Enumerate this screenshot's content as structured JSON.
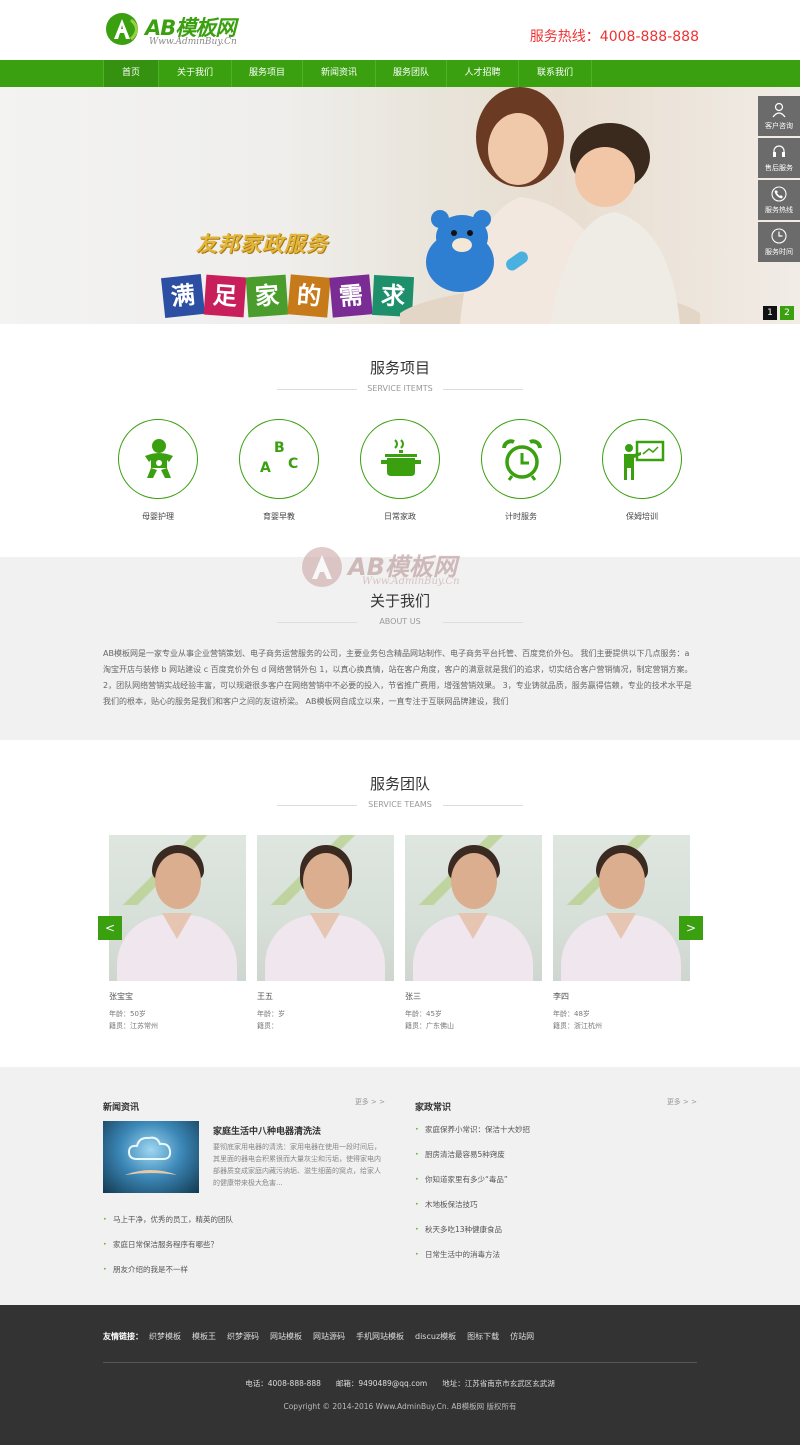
{
  "brand": {
    "name": "AB模板网",
    "url": "Www.AdminBuy.Cn",
    "hotline": "服务热线：4008-888-888",
    "accent": "#3aa010"
  },
  "nav": {
    "items": [
      "首页",
      "关于我们",
      "服务项目",
      "新闻资讯",
      "服务团队",
      "人才招聘",
      "联系我们"
    ]
  },
  "banner": {
    "title": "友邦家政服务",
    "tiles": [
      "满",
      "足",
      "家",
      "的",
      "需",
      "求"
    ],
    "tile_colors": [
      "#2c4fa3",
      "#c81e5a",
      "#4a9d2d",
      "#c77a1a",
      "#7a2b94",
      "#1d8f6a"
    ],
    "pager": [
      "1",
      "2"
    ]
  },
  "sidefloat": {
    "items": [
      {
        "label": "客户咨询",
        "icon": "user-icon"
      },
      {
        "label": "售后服务",
        "icon": "headset-icon"
      },
      {
        "label": "服务热线",
        "icon": "phone-icon"
      },
      {
        "label": "服务时间",
        "icon": "clock-icon"
      }
    ]
  },
  "services": {
    "title": "服务项目",
    "subtitle": "SERVICE ITEMTS",
    "items": [
      {
        "label": "母婴护理",
        "icon": "baby-icon"
      },
      {
        "label": "育婴早教",
        "icon": "abc-icon"
      },
      {
        "label": "日常家政",
        "icon": "pot-icon"
      },
      {
        "label": "计时服务",
        "icon": "alarm-clock-icon"
      },
      {
        "label": "保姆培训",
        "icon": "teacher-icon"
      }
    ]
  },
  "about": {
    "title": "关于我们",
    "subtitle": "ABOUT US",
    "watermark_name": "AB模板网",
    "watermark_url": "Www.AdminBuy.Cn",
    "text": "AB模板网是一家专业从事企业营销策划、电子商务运营服务的公司，主要业务包含精品网站制作、电子商务平台托管、百度竞价外包。 我们主要提供以下几点服务：a 淘宝开店与装修 b 网站建设 c 百度竞价外包 d 网络营销外包 1，以真心换真情，站在客户角度，客户的满意就是我们的追求，切实结合客户营销情况，制定营销方案。 2，团队网络营销实战经验丰富，可以规避很多客户在网络营销中不必要的投入，节省推广费用，增强营销效果。 3，专业铸就品质，服务赢得信赖，专业的技术水平是我们的根本，贴心的服务是我们和客户之间的友谊桥梁。 AB模板网自成立以来，一直专注于互联网品牌建设，我们"
  },
  "team": {
    "title": "服务团队",
    "subtitle": "SERVICE TEAMS",
    "prev": "<",
    "next": ">",
    "members": [
      {
        "name": "张宝宝",
        "age": "年龄：50岁",
        "origin": "籍贯：江苏常州"
      },
      {
        "name": "王五",
        "age": "年龄：岁",
        "origin": "籍贯："
      },
      {
        "name": "张三",
        "age": "年龄：45岁",
        "origin": "籍贯：广东佛山"
      },
      {
        "name": "李四",
        "age": "年龄：48岁",
        "origin": "籍贯：浙江杭州"
      }
    ]
  },
  "news": {
    "title": "新闻资讯",
    "more": "更多 > >",
    "feature_title": "家庭生活中八种电器清洗法",
    "feature_text": "要彻底家用电器的清洗：家用电器在使用一段时间后，其里面的器电会积累很而大量灰尘和污垢，使得家电内部器质变成家庭内藏污纳垢、滋生细菌的窝点，给家人的健康带来极大危害...",
    "items": [
      "马上干净，优秀的员工，精英的团队",
      "家庭日常保洁服务程序有哪些？",
      "朋友介绍的我是不一样"
    ]
  },
  "tips": {
    "title": "家政常识",
    "more": "更多 > >",
    "items": [
      "家庭保养小常识：保洁十大妙招",
      "厨房清洁最容易5种窍废",
      "你知道家里有多少“毒品”",
      "木地板保洁技巧",
      "秋天多吃13种健康食品",
      "日常生活中的消毒方法"
    ]
  },
  "footer": {
    "links_label": "友情链接：",
    "links": [
      "织梦模板",
      "模板王",
      "织梦源码",
      "网站模板",
      "网站源码",
      "手机网站模板",
      "discuz模板",
      "图标下载",
      "仿站网"
    ],
    "contact": "电话：4008-888-888　　邮箱：9490489@qq.com　　地址：江苏省南京市玄武区玄武湖",
    "copyright": "Copyright © 2014-2016 Www.AdminBuy.Cn. AB模板网 版权所有"
  }
}
